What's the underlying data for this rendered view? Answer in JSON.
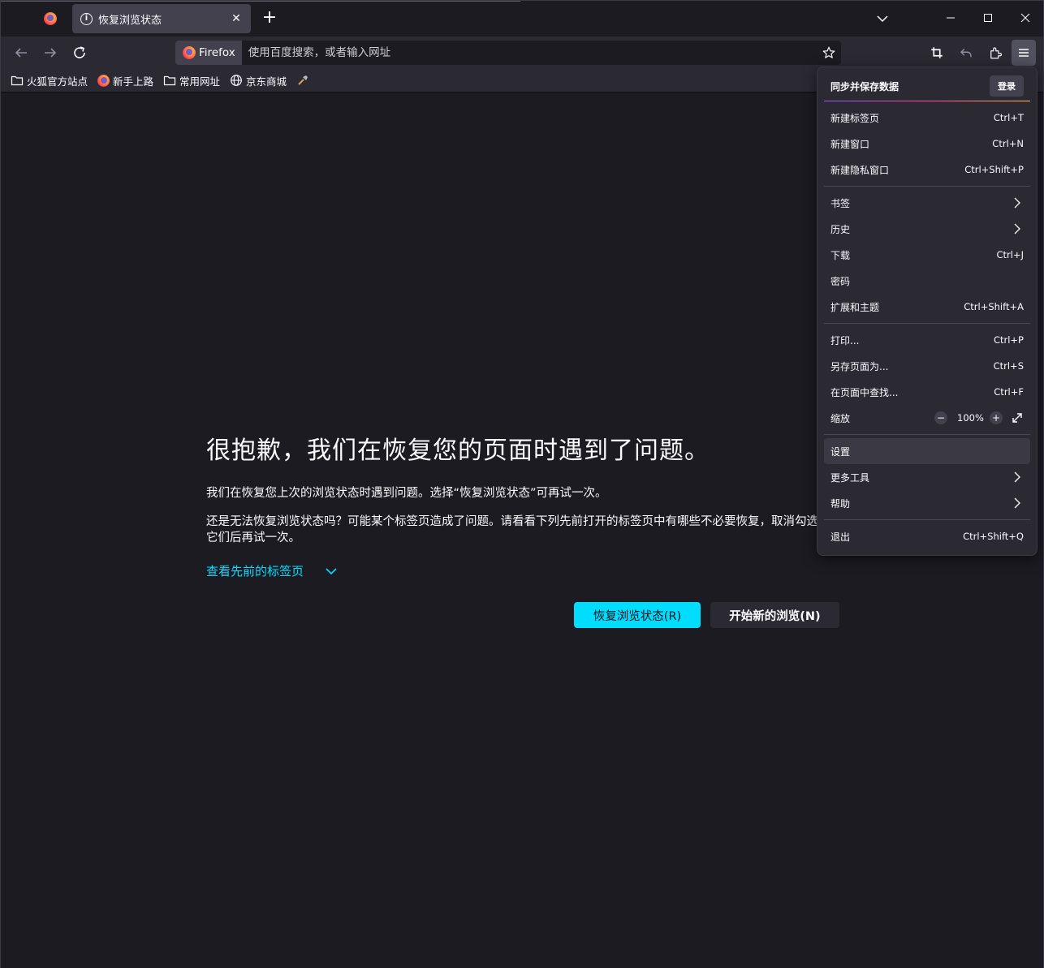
{
  "tab": {
    "title": "恢复浏览状态"
  },
  "urlbar": {
    "identity_label": "Firefox",
    "placeholder": "使用百度搜索，或者输入网址"
  },
  "bookmarks": [
    {
      "label": "火狐官方站点",
      "icon": "folder-icon"
    },
    {
      "label": "新手上路",
      "icon": "firefox-icon"
    },
    {
      "label": "常用网址",
      "icon": "folder-icon"
    },
    {
      "label": "京东商城",
      "icon": "globe-icon"
    }
  ],
  "content": {
    "title": "很抱歉，我们在恢复您的页面时遇到了问题。",
    "paragraph1": "我们在恢复您上次的浏览状态时遇到问题。选择“恢复浏览状态”可再试一次。",
    "paragraph2": "还是无法恢复浏览状态吗？可能某个标签页造成了问题。请看看下列先前打开的标签页中有哪些不必要恢复，取消勾选它们后再试一次。",
    "toggle_tabs": "查看先前的标签页",
    "restore_button": "恢复浏览状态(R)",
    "new_session_button": "开始新的浏览(N)"
  },
  "menu": {
    "header": "同步并保存数据",
    "login": "登录",
    "new_tab": {
      "label": "新建标签页",
      "shortcut": "Ctrl+T"
    },
    "new_window": {
      "label": "新建窗口",
      "shortcut": "Ctrl+N"
    },
    "new_private": {
      "label": "新建隐私窗口",
      "shortcut": "Ctrl+Shift+P"
    },
    "bookmarks": {
      "label": "书签"
    },
    "history": {
      "label": "历史"
    },
    "downloads": {
      "label": "下载",
      "shortcut": "Ctrl+J"
    },
    "passwords": {
      "label": "密码"
    },
    "addons": {
      "label": "扩展和主题",
      "shortcut": "Ctrl+Shift+A"
    },
    "print": {
      "label": "打印...",
      "shortcut": "Ctrl+P"
    },
    "save_page": {
      "label": "另存页面为...",
      "shortcut": "Ctrl+S"
    },
    "find": {
      "label": "在页面中查找...",
      "shortcut": "Ctrl+F"
    },
    "zoom": {
      "label": "缩放",
      "minus": "−",
      "value": "100%",
      "plus": "+"
    },
    "settings": {
      "label": "设置"
    },
    "more_tools": {
      "label": "更多工具"
    },
    "help": {
      "label": "帮助"
    },
    "quit": {
      "label": "退出",
      "shortcut": "Ctrl+Shift+Q"
    }
  },
  "colors": {
    "accent": "#00ddff",
    "background": "#1c1b22",
    "toolbar": "#2b2a33"
  }
}
